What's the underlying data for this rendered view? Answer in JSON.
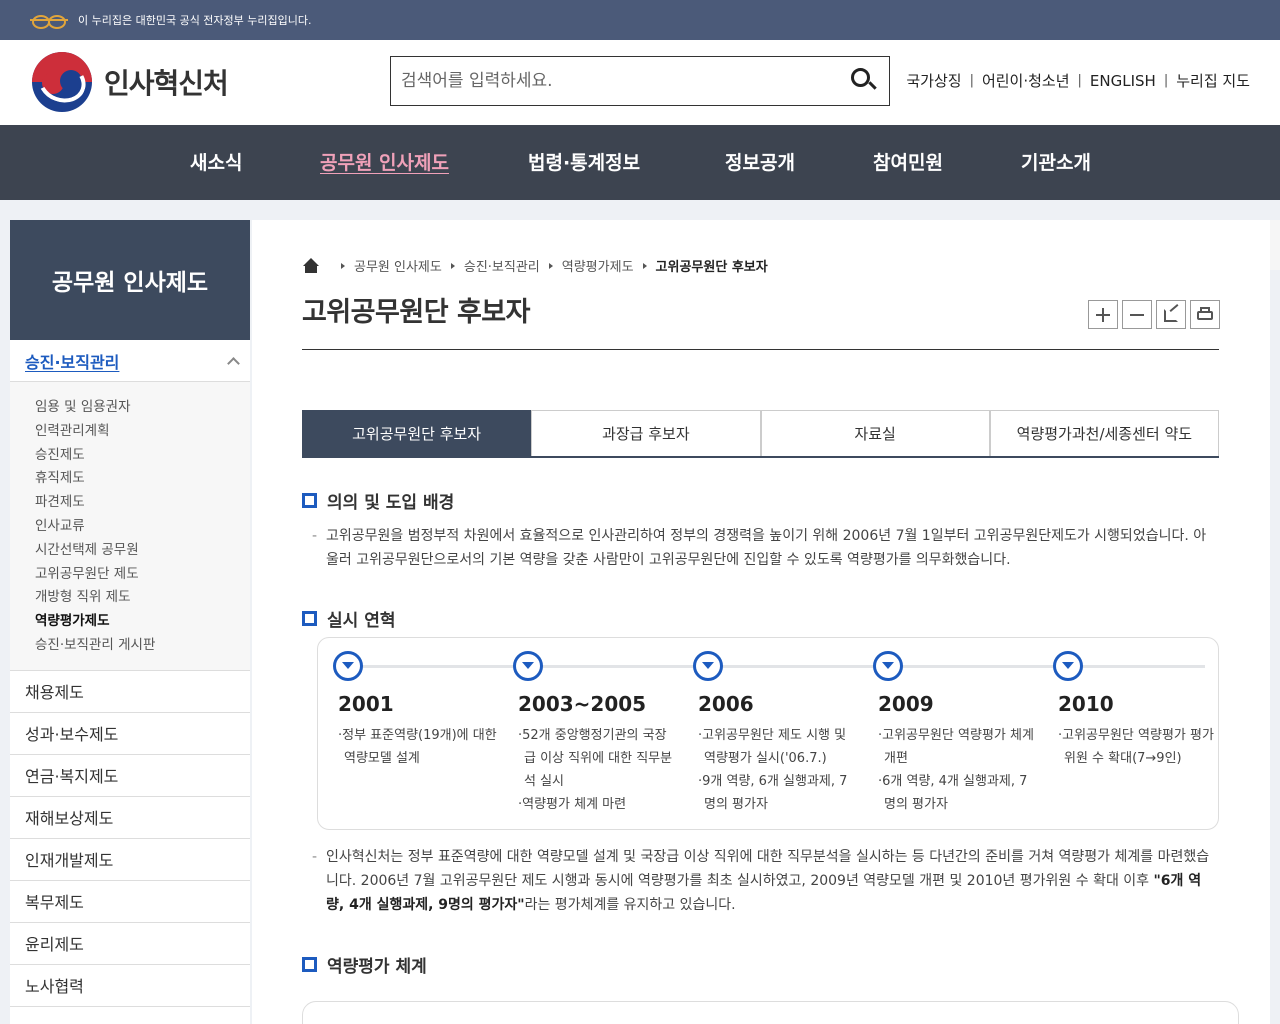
{
  "banner": {
    "text": "이 누리집은 대한민국 공식 전자정부 누리집입니다."
  },
  "header": {
    "logo_text": "인사혁신처",
    "search_placeholder": "검색어를 입력하세요.",
    "util_links": [
      "국가상징",
      "어린이·청소년",
      "ENGLISH",
      "누리집 지도"
    ]
  },
  "nav": {
    "items": [
      "새소식",
      "공무원 인사제도",
      "법령·통계정보",
      "정보공개",
      "참여민원",
      "기관소개"
    ],
    "active_index": 1
  },
  "sidebar": {
    "title": "공무원 인사제도",
    "current": "승진·보직관리",
    "sub_items": [
      "임용 및 임용권자",
      "인력관리계획",
      "승진제도",
      "휴직제도",
      "파견제도",
      "인사교류",
      "시간선택제 공무원",
      "고위공무원단 제도",
      "개방형 직위 제도",
      "역량평가제도",
      "승진·보직관리 게시판"
    ],
    "active_sub": "역량평가제도",
    "items": [
      "채용제도",
      "성과·보수제도",
      "연금·복지제도",
      "재해보상제도",
      "인재개발제도",
      "복무제도",
      "윤리제도",
      "노사협력"
    ]
  },
  "breadcrumb": [
    "공무원 인사제도",
    "승진·보직관리",
    "역량평가제도",
    "고위공무원단 후보자"
  ],
  "page_title": "고위공무원단 후보자",
  "tools": [
    "zoom-in",
    "zoom-out",
    "share",
    "print"
  ],
  "tabs": [
    "고위공무원단 후보자",
    "과장급 후보자",
    "자료실",
    "역량평가과천/세종센터 약도"
  ],
  "sections": {
    "s1_title": "의의 및 도입 배경",
    "s1_text": "고위공무원을 범정부적 차원에서 효율적으로 인사관리하여 정부의 경쟁력을 높이기 위해 2006년 7월 1일부터 고위공무원단제도가 시행되었습니다. 아울러 고위공무원단으로서의 기본 역량을 갖춘 사람만이 고위공무원단에 진입할 수 있도록 역량평가를 의무화했습니다.",
    "s2_title": "실시 연혁",
    "timeline": [
      {
        "year": "2001",
        "lines": [
          "·정부 표준역량(19개)에 대한 역량모델 설계"
        ]
      },
      {
        "year": "2003~2005",
        "lines": [
          "·52개 중앙행정기관의 국장급 이상 직위에 대한 직무분석 실시",
          "·역량평가 체계 마련"
        ]
      },
      {
        "year": "2006",
        "lines": [
          "·고위공무원단 제도 시행 및 역량평가 실시('06.7.)",
          "·9개 역량, 6개 실행과제, 7명의 평가자"
        ]
      },
      {
        "year": "2009",
        "lines": [
          "·고위공무원단 역량평가 체계 개편",
          "·6개 역량, 4개 실행과제, 7명의 평가자"
        ]
      },
      {
        "year": "2010",
        "lines": [
          "·고위공무원단 역량평가 평가위원 수 확대(7→9인)"
        ]
      }
    ],
    "s2_text_a": "인사혁신처는 정부 표준역량에 대한 역량모델 설계 및 국장급 이상 직위에 대한 직무분석을 실시하는 등 다년간의 준비를 거쳐 역량평가 체계를 마련했습니다. 2006년 7월 고위공무원단 제도 시행과 동시에 역량평가를 최초 실시하였고, 2009년 역량모델 개편 및 2010년 평가위원 수 확대 이후 ",
    "s2_text_bold": "\"6개 역량, 4개 실행과제, 9명의 평가자\"",
    "s2_text_b": "라는 평가체계를 유지하고 있습니다.",
    "s3_title": "역량평가 체계"
  },
  "colors": {
    "nav_bg": "#3d4450",
    "accent_blue": "#1d5bbf",
    "active_nav": "#f0a1b9",
    "side_title_bg": "#3d4a5e"
  }
}
